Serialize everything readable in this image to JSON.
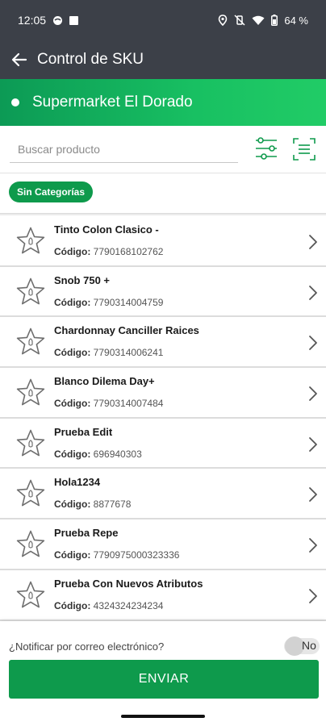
{
  "status_bar": {
    "time": "12:05",
    "battery": "64 %"
  },
  "app_bar": {
    "title": "Control de SKU",
    "back_icon": "arrow-left-icon"
  },
  "store": {
    "name": "Supermarket El Dorado",
    "indicator_color": "#ffffff"
  },
  "search": {
    "placeholder": "Buscar producto",
    "value": ""
  },
  "category_chip": {
    "label": "Sin Categorías"
  },
  "products": [
    {
      "name": "Tinto Colon Clasico -",
      "code_label": "Código:",
      "code": "7790168102762"
    },
    {
      "name": "Snob 750 +",
      "code_label": "Código:",
      "code": "7790314004759"
    },
    {
      "name": "Chardonnay Canciller Raices",
      "code_label": "Código:",
      "code": "7790314006241"
    },
    {
      "name": "Blanco Dilema Day+",
      "code_label": "Código:",
      "code": "7790314007484"
    },
    {
      "name": "Prueba Edit",
      "code_label": "Código:",
      "code": "696940303"
    },
    {
      "name": "Hola1234",
      "code_label": "Código:",
      "code": "8877678"
    },
    {
      "name": "Prueba Repe",
      "code_label": "Código:",
      "code": "7790975000323336"
    },
    {
      "name": "Prueba Con Nuevos Atributos",
      "code_label": "Código:",
      "code": "4324324234234"
    }
  ],
  "bottom": {
    "notify_label": "¿Notificar por correo electrónico?",
    "toggle_text": "No",
    "toggle_on": false,
    "send_label": "ENVIAR"
  },
  "colors": {
    "accent_green": "#0e9a4c",
    "header_dark": "#3c4048"
  }
}
